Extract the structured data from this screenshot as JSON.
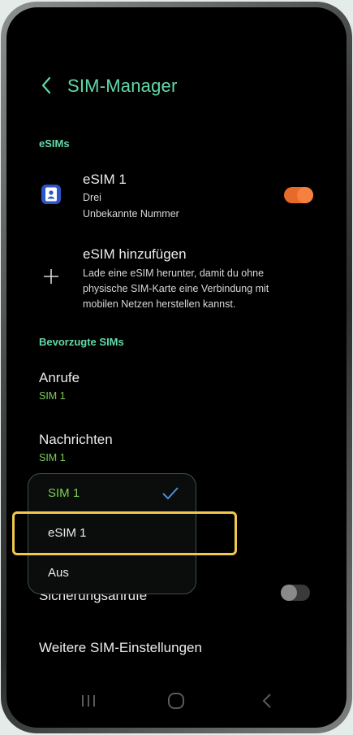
{
  "header": {
    "title": "SIM-Manager",
    "back_icon": "chevron-left-icon"
  },
  "esims": {
    "section_label": "eSIMs",
    "items": [
      {
        "title": "eSIM 1",
        "carrier": "Drei",
        "number": "Unbekannte Nummer",
        "enabled": true,
        "icon": "sim-card-icon"
      }
    ],
    "add": {
      "title": "eSIM hinzufügen",
      "description_lines": [
        "Lade eine eSIM herunter, damit du ohne",
        "physische SIM-Karte eine Verbindung mit",
        "mobilen Netzen herstellen kannst."
      ],
      "icon": "plus-icon"
    }
  },
  "preferred": {
    "section_label": "Bevorzugte SIMs",
    "calls": {
      "title": "Anrufe",
      "value": "SIM 1"
    },
    "messages": {
      "title": "Nachrichten",
      "value": "SIM 1"
    },
    "backup_calls": {
      "title": "Sicherungsanrufe",
      "enabled": false
    }
  },
  "dropdown": {
    "options": [
      {
        "label": "SIM 1",
        "selected": true
      },
      {
        "label": "eSIM 1",
        "selected": false,
        "highlighted": true
      },
      {
        "label": "Aus",
        "selected": false
      }
    ]
  },
  "more_settings": "Weitere SIM-Einstellungen",
  "colors": {
    "accent": "#62d8a8",
    "sub_green": "#7bcf55",
    "toggle_on": "#e86a2a",
    "highlight": "#f1c84a",
    "check": "#4b8fd6"
  },
  "nav_bar": {
    "icons": [
      "recents-icon",
      "home-icon",
      "back-icon"
    ]
  }
}
